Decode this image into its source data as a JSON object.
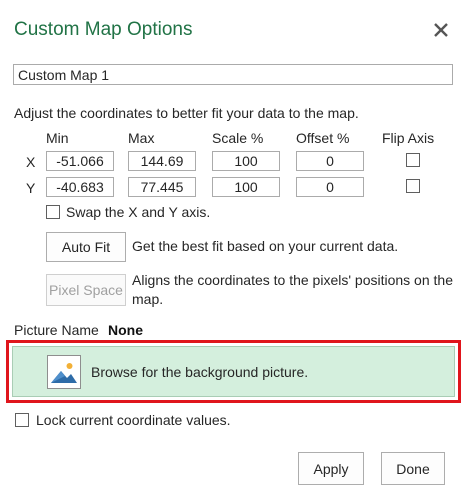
{
  "dialog": {
    "title": "Custom Map Options",
    "close_icon": "close-icon"
  },
  "map_name": {
    "value": "Custom Map 1"
  },
  "coords": {
    "description": "Adjust the coordinates to better fit your data to the map.",
    "headers": {
      "min": "Min",
      "max": "Max",
      "scale": "Scale %",
      "offset": "Offset %",
      "flip": "Flip Axis"
    },
    "rows": [
      {
        "label": "X",
        "min": "-51.066",
        "max": "144.69",
        "scale": "100",
        "offset": "0",
        "flip": false
      },
      {
        "label": "Y",
        "min": "-40.683",
        "max": "77.445",
        "scale": "100",
        "offset": "0",
        "flip": false
      }
    ]
  },
  "swap_axis": {
    "label": "Swap the X and Y axis.",
    "checked": false
  },
  "auto_fit": {
    "button_label": "Auto Fit",
    "description": "Get the best fit based on your current data."
  },
  "pixel_space": {
    "button_label": "Pixel Space",
    "description_line1": "Aligns the coordinates to the pixels' positions on the",
    "description_line2": "map.",
    "enabled": false
  },
  "picture": {
    "label": "Picture Name",
    "value": "None",
    "browse_label": "Browse for the background picture.",
    "browse_icon": "picture-icon",
    "highlight_color": "#e0151c",
    "fill_color": "#d4efdd"
  },
  "lock_coords": {
    "label": "Lock current coordinate values.",
    "checked": false
  },
  "footer": {
    "apply_label": "Apply",
    "done_label": "Done"
  },
  "colors": {
    "title": "#217346",
    "text": "#262626"
  }
}
